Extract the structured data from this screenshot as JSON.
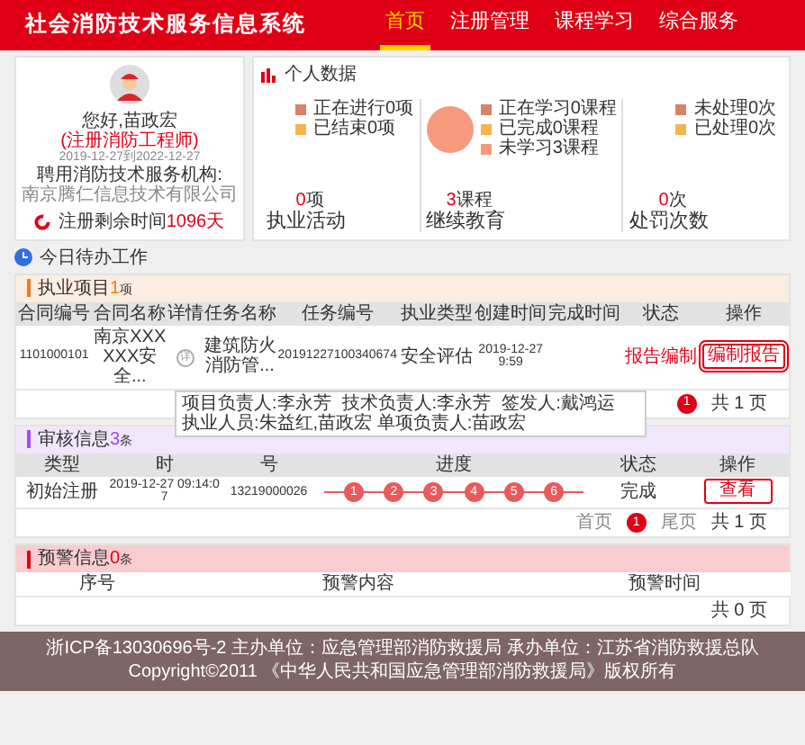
{
  "header": {
    "title": "社会消防技术服务信息系统",
    "nav": [
      {
        "label": "首页",
        "selected": true
      },
      {
        "label": "注册管理",
        "selected": false
      },
      {
        "label": "课程学习",
        "selected": false
      },
      {
        "label": "综合服务",
        "selected": false
      }
    ]
  },
  "profile": {
    "greeting": "您好,苗政宏",
    "role": "(注册消防工程师)",
    "period": "2019-12-27到2022-12-27",
    "org_label": "聘用消防技术服务机构:",
    "org": "南京腾仁信息技术有限公司",
    "remaining_label": "注册剩余时间",
    "remaining_value": "1096天"
  },
  "personal_data": {
    "title": "个人数据",
    "groups": [
      {
        "kind": "legend",
        "legend": [
          {
            "label": "正在进行0项",
            "color": "#d9826a"
          },
          {
            "label": "已结束0项",
            "color": "#f5b54a"
          }
        ],
        "value": "0",
        "unit": "项",
        "name": "执业活动"
      },
      {
        "kind": "pie",
        "legend": [
          {
            "label": "正在学习0课程",
            "color": "#d9826a"
          },
          {
            "label": "已完成0课程",
            "color": "#f5b54a"
          },
          {
            "label": "未学习3课程",
            "color": "#f7997c"
          }
        ],
        "value": "3",
        "unit": "课程",
        "name": "继续教育"
      },
      {
        "kind": "legend",
        "legend": [
          {
            "label": "未处理0次",
            "color": "#d9826a"
          },
          {
            "label": "已处理0次",
            "color": "#f5b54a"
          }
        ],
        "value": "0",
        "unit": "次",
        "name": "处罚次数"
      }
    ]
  },
  "todo_title": "今日待办工作",
  "practice": {
    "title": "执业项目",
    "count": "1",
    "unit": "项",
    "columns": [
      "合同编号",
      "合同名称",
      "详情",
      "任务名称",
      "任务编号",
      "执业类型",
      "创建时间",
      "完成时间",
      "状态",
      "操作"
    ],
    "rows": [
      {
        "contract_no": "1101000101",
        "contract_name": "南京XXXXXX安全...",
        "detail_icon": "详",
        "task_name": "建筑防火消防管...",
        "task_no": "20191227100340674",
        "type": "安全评估",
        "created": "2019-12-27 9:59",
        "status": "报告编制",
        "action": "编制报告"
      }
    ],
    "pages": [
      "1"
    ],
    "total": "共 1 页",
    "tooltip": [
      "项目负责人:李永芳",
      "技术负责人:李永芳",
      "签发人:戴鸿运",
      "执业人员:朱益红,苗政宏 单项负责人:苗政宏"
    ]
  },
  "review": {
    "title": "审核信息",
    "count": "3",
    "unit": "条",
    "columns": [
      "类型",
      "时",
      "号",
      "进度",
      "状态",
      "操作"
    ],
    "rows": [
      {
        "type": "初始注册",
        "time": "2019-12-27 09:14:07",
        "number": "13219000026",
        "steps": [
          "1",
          "2",
          "3",
          "4",
          "5",
          "6"
        ],
        "status": "完成",
        "action": "查看"
      }
    ],
    "first": "首页",
    "pages": [
      "1"
    ],
    "last": "尾页",
    "total": "共 1 页"
  },
  "warning": {
    "title": "预警信息",
    "count": "0",
    "unit": "条",
    "columns": [
      "序号",
      "预警内容",
      "预警时间"
    ],
    "total": "共 0 页"
  },
  "footer": [
    "浙ICP备13030696号-2 主办单位：应急管理部消防救援局 承办单位：江苏省消防救援总队",
    "Copyright©2011 《中华人民共和国应急管理部消防救援局》版权所有"
  ]
}
